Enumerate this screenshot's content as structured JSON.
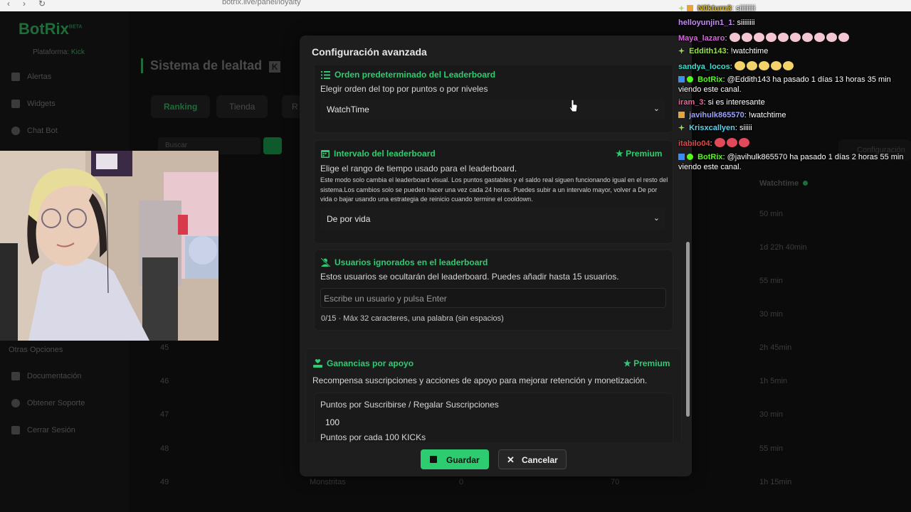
{
  "browser": {
    "url": "botrix.live/panel/loyalty",
    "back": "‹",
    "forward": "›",
    "reload": "↻"
  },
  "background": {
    "logo": "BotRix",
    "logo_badge": "BETA",
    "platform_label": "Plataforma:",
    "platform_value": "Kick",
    "sidebar_items": [
      "Alertas",
      "Widgets",
      "Chat Bot"
    ],
    "other_options_label": "Otras Opciones",
    "other_items": [
      "Documentación",
      "Obtener Soporte",
      "Cerrar Sesión"
    ],
    "page_title": "Sistema de lealtad",
    "page_title_icon": "K",
    "tabs": [
      "Ranking",
      "Tienda",
      "R"
    ],
    "search_placeholder": "Buscar",
    "config_button": "Configuración",
    "watchtime_header": "Watchtime",
    "watchtime_values": [
      "50 min",
      "1d 22h 40min",
      "55 min",
      "30 min",
      "2h 45min",
      "1h 5min",
      "30 min",
      "55 min",
      "1h 15min"
    ],
    "rank_numbers": [
      "45",
      "46",
      "47",
      "48",
      "49"
    ],
    "last_row_name": "Monstritas",
    "last_row_zero": "0",
    "last_row_seventy": "70"
  },
  "modal": {
    "title": "Configuración avanzada",
    "order": {
      "title": "Orden predeterminado del Leaderboard",
      "description": "Elegir orden del top por puntos o por niveles",
      "selected": "WatchTime"
    },
    "interval": {
      "title": "Intervalo del leaderboard",
      "premium": "Premium",
      "description": "Elige el rango de tiempo usado para el leaderboard.",
      "details": "Este modo solo cambia el leaderboard visual. Los puntos gastables y el saldo real siguen funcionando igual en el resto del sistema.Los cambios solo se pueden hacer una vez cada 24 horas. Puedes subir a un intervalo mayor, volver a De por vida o bajar usando una estrategia de reinicio cuando termine el cooldown.",
      "selected": "De por vida"
    },
    "ignored": {
      "title": "Usuarios ignorados en el leaderboard",
      "description": "Estos usuarios se ocultarán del leaderboard. Puedes añadir hasta 15 usuarios.",
      "placeholder": "Escribe un usuario y pulsa Enter",
      "hint": "0/15 · Máx 32 caracteres, una palabra (sin espacios)"
    },
    "support": {
      "title": "Ganancias por apoyo",
      "premium": "Premium",
      "description": "Recompensa suscripciones y acciones de apoyo para mejorar retención y monetización.",
      "subs_label": "Puntos por Suscribirse / Regalar Suscripciones",
      "subs_value": "100",
      "kicks_label": "Puntos por cada 100 KICKs"
    },
    "save": "Guardar",
    "cancel": "Cancelar"
  },
  "chat": [
    {
      "user": "N0kturn3",
      "color": "#d4b52a",
      "message": "siiiiiiiii"
    },
    {
      "user": "helloyunjin1_1",
      "color": "#c48af5",
      "message": "siiiiiiii"
    },
    {
      "user": "Maya_lazaro",
      "color": "#d16ad6",
      "message": ""
    },
    {
      "user": "Eddith143",
      "color": "#9ae34a",
      "message": "!watchtime"
    },
    {
      "user": "sandya_locos",
      "color": "#3ae0d0",
      "message": ""
    },
    {
      "user": "BotRix",
      "color": "#53fc18",
      "message": "@Eddith143 ha pasado 1 días 13 horas 35 min viendo este canal."
    },
    {
      "user": "iram_3",
      "color": "#e06a9a",
      "message": "si es interesante"
    },
    {
      "user": "javihulk865570",
      "color": "#9aa3f5",
      "message": "!watchtime"
    },
    {
      "user": "Krisxcallyen",
      "color": "#5ad3f0",
      "message": "siiiii"
    },
    {
      "user": "itabilo04",
      "color": "#e04a4a",
      "message": ""
    },
    {
      "user": "BotRix",
      "color": "#53fc18",
      "message": "@javihulk865570 ha pasado 1 días 2 horas 55 min viendo este canal."
    }
  ]
}
